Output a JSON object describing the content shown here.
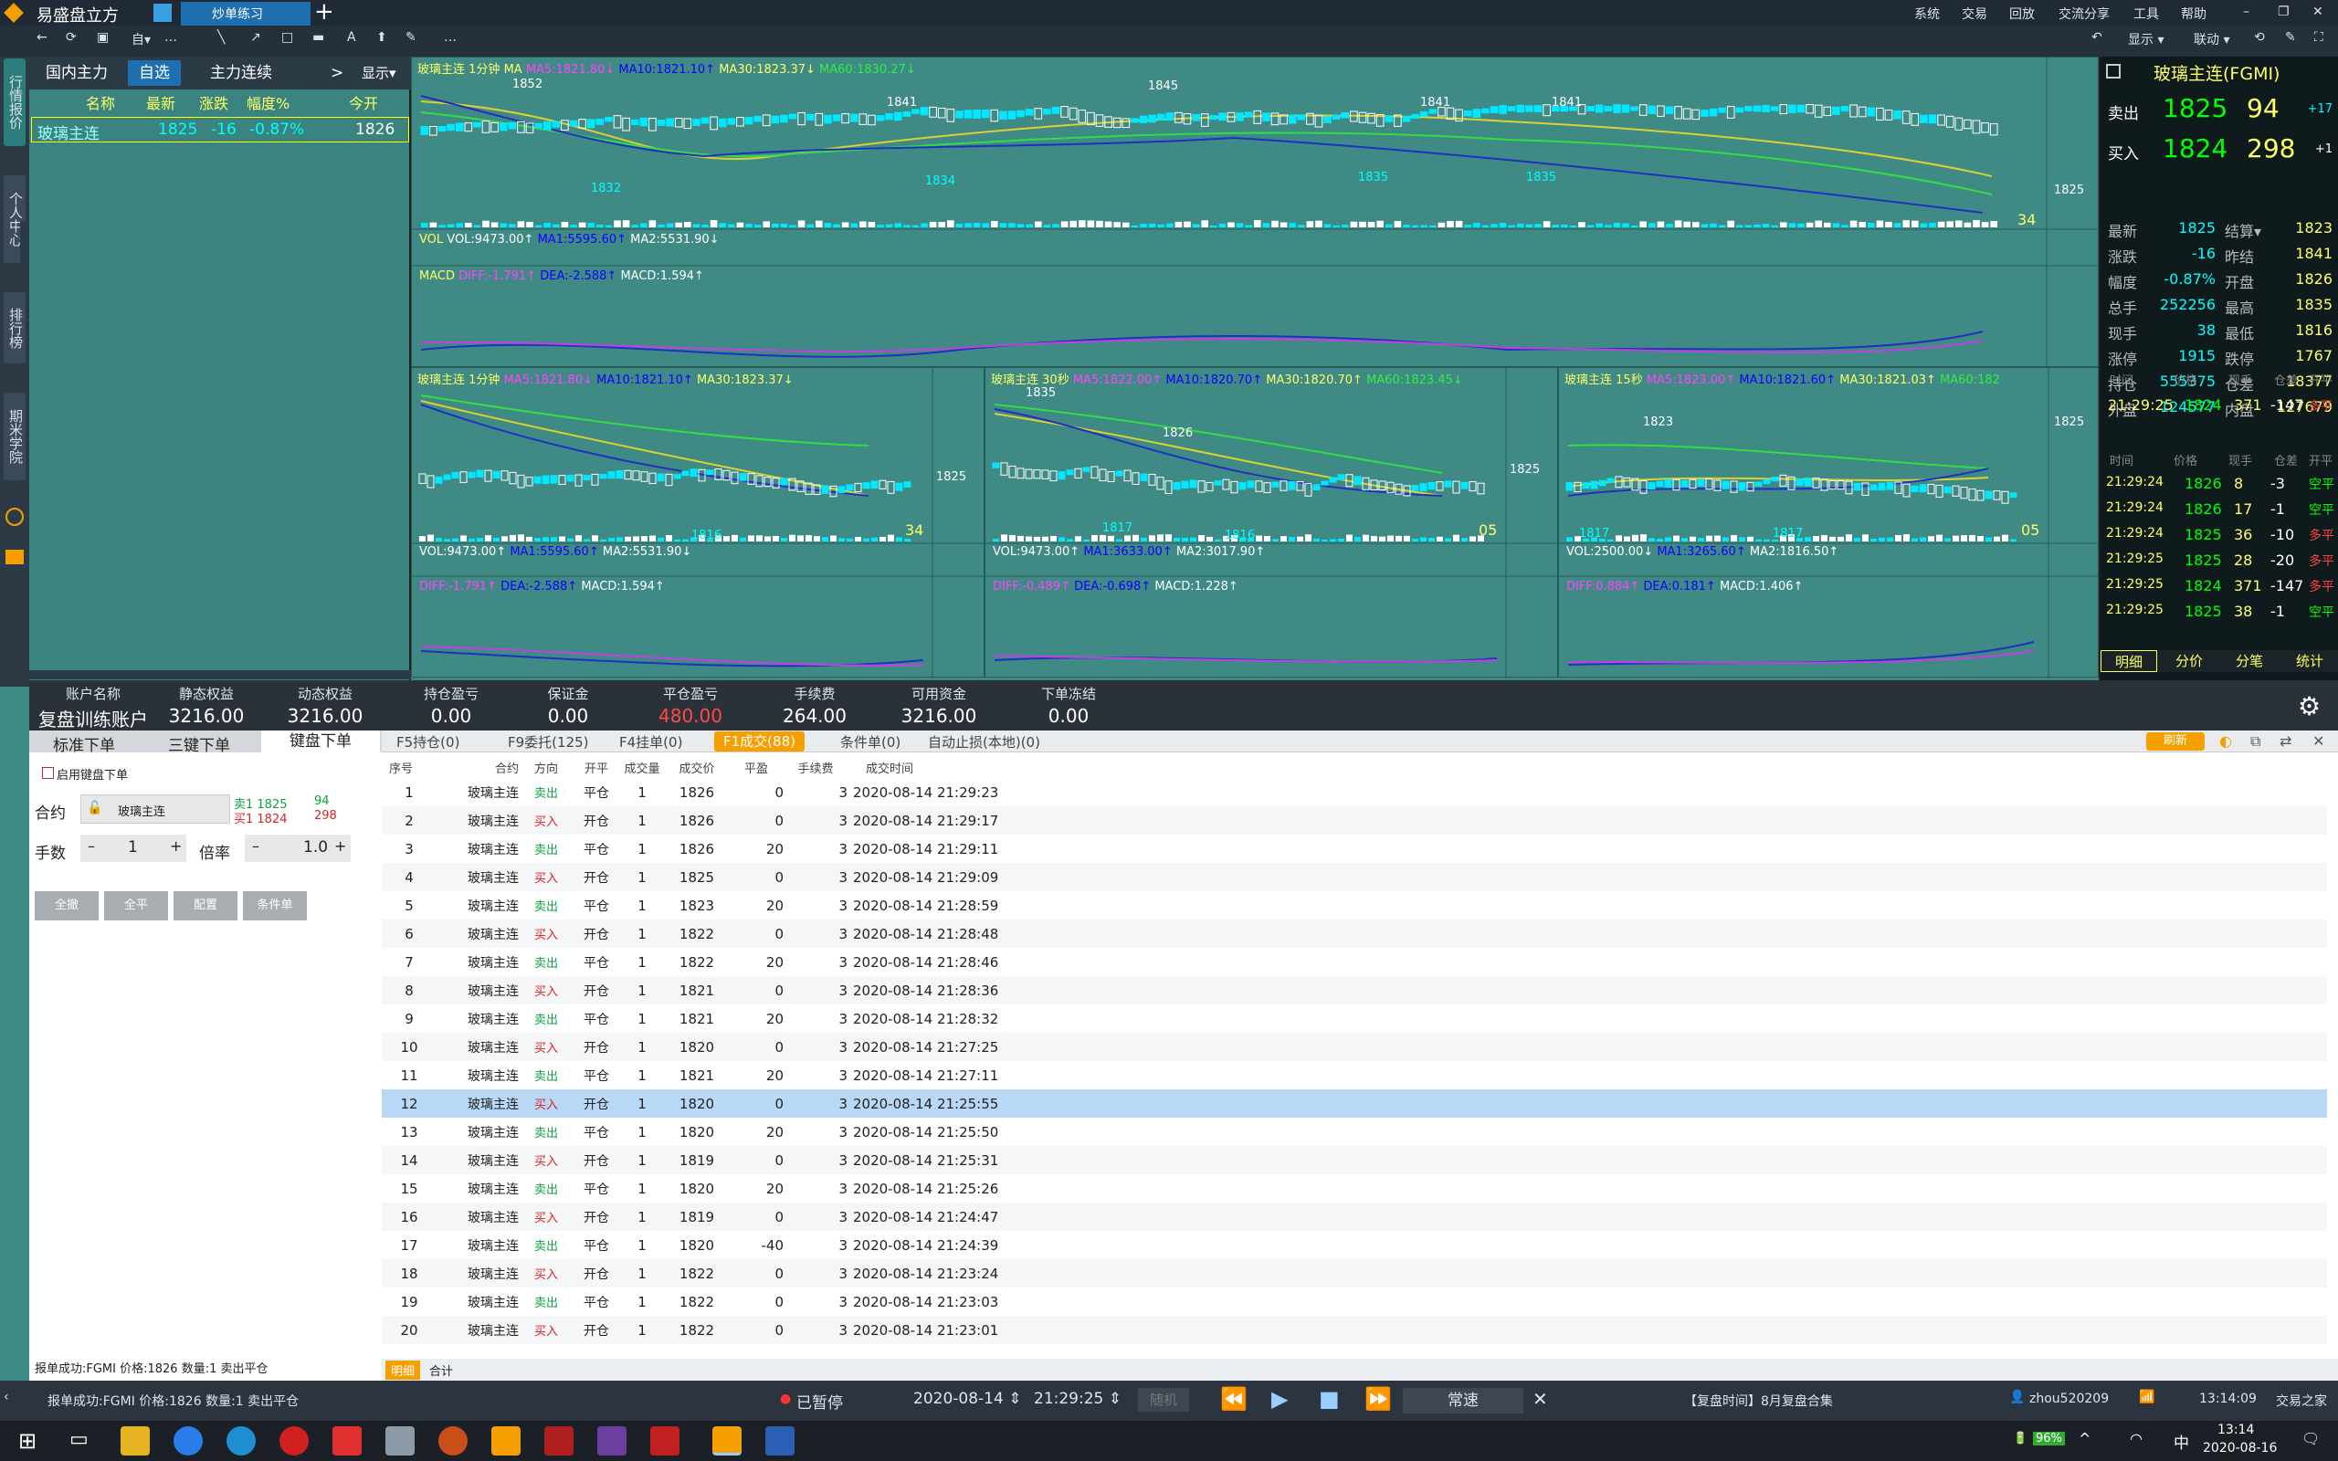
{
  "app": {
    "title": "易盛盘立方",
    "tab": "炒单练习",
    "menus": [
      "系统",
      "交易",
      "回放",
      "交流分享",
      "工具",
      "帮助"
    ],
    "display": "显示",
    "link": "联动"
  },
  "leftbar": [
    "行情报价",
    "个人中心",
    "排行榜",
    "期米学院"
  ],
  "watch": {
    "tabs": [
      "国内主力",
      "自选",
      "主力连续"
    ],
    "more": ">",
    "display": "显示▾",
    "headers": [
      "名称",
      "最新",
      "涨跌",
      "幅度%",
      "今开"
    ],
    "rows": [
      {
        "name": "玻璃主连",
        "last": "1825",
        "chg": "-16",
        "pct": "-0.87%",
        "open": "1826"
      }
    ]
  },
  "charts": {
    "main": {
      "title": "玻璃主连",
      "period": "1分钟",
      "ma": "MA",
      "ma5": "MA5:1821.80↓",
      "ma10": "MA10:1821.10↑",
      "ma30": "MA30:1823.37↓",
      "ma60": "MA60:1830.27↓",
      "vol": "VOL",
      "vol_v": "VOL:9473.00↑",
      "vol_ma1": "MA1:5595.60↑",
      "vol_ma2": "MA2:5531.90↓",
      "macd": "MACD",
      "diff": "DIFF:-1.791↑",
      "dea": "DEA:-2.588↑",
      "macd_v": "MACD:1.594↑",
      "highs": [
        "1852",
        "1841",
        "1845",
        "1841",
        "1841"
      ],
      "lows": [
        "1832",
        "1834",
        "1835",
        "1835"
      ],
      "price": "1825",
      "count": "34"
    },
    "c1": {
      "title": "玻璃主连",
      "period": "1分钟",
      "ma5": "MA5:1821.80↓",
      "ma10": "MA10:1821.10↑",
      "ma30": "MA30:1823.37↓",
      "ma60": "MA60:1830.27↓",
      "vol_v": "VOL:9473.00↑",
      "vol_ma1": "MA1:5595.60↑",
      "vol_ma2": "MA2:5531.90↓",
      "diff": "DIFF:-1.791↑",
      "dea": "DEA:-2.588↑",
      "macd_v": "MACD:1.594↑",
      "low": "1816",
      "price": "1825",
      "count": "34"
    },
    "c2": {
      "title": "玻璃主连",
      "period": "30秒",
      "ma5": "MA5:1822.00↑",
      "ma10": "MA10:1820.70↑",
      "ma30": "MA30:1820.70↑",
      "ma60": "MA60:1823.45↓",
      "vol_v": "VOL:9473.00↑",
      "vol_ma1": "MA1:3633.00↑",
      "vol_ma2": "MA2:3017.90↑",
      "diff": "DIFF:-0.489↑",
      "dea": "DEA:-0.698↑",
      "macd_v": "MACD:1.228↑",
      "high": "1835",
      "mid": "1826",
      "low1": "1817",
      "low2": "1816",
      "price": "1825",
      "count": "05"
    },
    "c3": {
      "title": "玻璃主连",
      "period": "15秒",
      "ma5": "MA5:1823.00↑",
      "ma10": "MA10:1821.60↑",
      "ma30": "MA30:1821.03↑",
      "ma60": "MA60:182",
      "vol_v": "VOL:2500.00↓",
      "vol_ma1": "MA1:3265.60↑",
      "vol_ma2": "MA2:1816.50↑",
      "diff": "DIFF:0.884↑",
      "dea": "DEA:0.181↑",
      "macd_v": "MACD:1.406↑",
      "high": "1823",
      "low1": "1817",
      "low2": "1817",
      "price": "1825",
      "count": "05"
    }
  },
  "quote": {
    "title": "玻璃主连(FGMI)",
    "sell_label": "卖出",
    "sell_price": "1825",
    "sell_vol": "94",
    "sell_chg": "+17",
    "buy_label": "买入",
    "buy_price": "1824",
    "buy_vol": "298",
    "buy_chg": "+1",
    "rows": [
      [
        "最新",
        "1825",
        "结算▾",
        "1823"
      ],
      [
        "涨跌",
        "-16",
        "昨结",
        "1841"
      ],
      [
        "幅度",
        "-0.87%",
        "开盘",
        "1826"
      ],
      [
        "总手",
        "252256",
        "最高",
        "1835"
      ],
      [
        "现手",
        "38",
        "最低",
        "1816"
      ],
      [
        "涨停",
        "1915",
        "跌停",
        "1767"
      ],
      [
        "持仓",
        "555375",
        "仓差",
        "18377"
      ],
      [
        "外盘",
        "124577",
        "内盘",
        "127679"
      ]
    ],
    "tick_headers": [
      "时间",
      "价格",
      "现手",
      "仓差",
      "开平"
    ],
    "tick_top": [
      "21:29:25",
      "1824",
      "371",
      "-147",
      "多平"
    ],
    "ticks": [
      [
        "21:29:24",
        "1826",
        "8",
        "-3",
        "空平"
      ],
      [
        "21:29:24",
        "1826",
        "17",
        "-1",
        "空平"
      ],
      [
        "21:29:24",
        "1825",
        "36",
        "-10",
        "多平"
      ],
      [
        "21:29:25",
        "1825",
        "28",
        "-20",
        "多平"
      ],
      [
        "21:29:25",
        "1824",
        "371",
        "-147",
        "多平"
      ],
      [
        "21:29:25",
        "1825",
        "38",
        "-1",
        "空平"
      ]
    ],
    "tabs": [
      "明细",
      "分价",
      "分笔",
      "统计"
    ]
  },
  "account": {
    "cols": [
      [
        "账户名称",
        "复盘训练账户"
      ],
      [
        "静态权益",
        "3216.00"
      ],
      [
        "动态权益",
        "3216.00"
      ],
      [
        "持仓盈亏",
        "0.00"
      ],
      [
        "保证金",
        "0.00"
      ],
      [
        "平仓盈亏",
        "480.00"
      ],
      [
        "手续费",
        "264.00"
      ],
      [
        "可用资金",
        "3216.00"
      ],
      [
        "下单冻结",
        "0.00"
      ]
    ]
  },
  "order": {
    "tabs": [
      "标准下单",
      "三键下单",
      "键盘下单"
    ],
    "enable": "启用键盘下单",
    "contract_label": "合约",
    "contract": "玻璃主连",
    "ask": "卖1 1825",
    "ask_vol": "94",
    "bid": "买1 1824",
    "bid_vol": "298",
    "qty_label": "手数",
    "qty": "1",
    "mult_label": "倍率",
    "mult": "1.0",
    "buttons": [
      "全撤",
      "全平",
      "配置",
      "条件单"
    ],
    "status": "报单成功:FGMI 价格:1826 数量:1 卖出平仓"
  },
  "fills": {
    "tabs": [
      "F5持仓(0)",
      "F9委托(125)",
      "F4挂单(0)",
      "F1成交(88)",
      "条件单(0)",
      "自动止损(本地)(0)"
    ],
    "refresh": "刷新",
    "headers": [
      "序号",
      "合约",
      "方向",
      "开平",
      "成交量",
      "成交价",
      "平盈",
      "手续费",
      "成交时间"
    ],
    "rows": [
      [
        "1",
        "玻璃主连",
        "卖出",
        "平仓",
        "1",
        "1826",
        "0",
        "3",
        "2020-08-14 21:29:23"
      ],
      [
        "2",
        "玻璃主连",
        "买入",
        "开仓",
        "1",
        "1826",
        "0",
        "3",
        "2020-08-14 21:29:17"
      ],
      [
        "3",
        "玻璃主连",
        "卖出",
        "平仓",
        "1",
        "1826",
        "20",
        "3",
        "2020-08-14 21:29:11"
      ],
      [
        "4",
        "玻璃主连",
        "买入",
        "开仓",
        "1",
        "1825",
        "0",
        "3",
        "2020-08-14 21:29:09"
      ],
      [
        "5",
        "玻璃主连",
        "卖出",
        "平仓",
        "1",
        "1823",
        "20",
        "3",
        "2020-08-14 21:28:59"
      ],
      [
        "6",
        "玻璃主连",
        "买入",
        "开仓",
        "1",
        "1822",
        "0",
        "3",
        "2020-08-14 21:28:48"
      ],
      [
        "7",
        "玻璃主连",
        "卖出",
        "平仓",
        "1",
        "1822",
        "20",
        "3",
        "2020-08-14 21:28:46"
      ],
      [
        "8",
        "玻璃主连",
        "买入",
        "开仓",
        "1",
        "1821",
        "0",
        "3",
        "2020-08-14 21:28:36"
      ],
      [
        "9",
        "玻璃主连",
        "卖出",
        "平仓",
        "1",
        "1821",
        "20",
        "3",
        "2020-08-14 21:28:32"
      ],
      [
        "10",
        "玻璃主连",
        "买入",
        "开仓",
        "1",
        "1820",
        "0",
        "3",
        "2020-08-14 21:27:25"
      ],
      [
        "11",
        "玻璃主连",
        "卖出",
        "平仓",
        "1",
        "1821",
        "20",
        "3",
        "2020-08-14 21:27:11"
      ],
      [
        "12",
        "玻璃主连",
        "买入",
        "开仓",
        "1",
        "1820",
        "0",
        "3",
        "2020-08-14 21:25:55"
      ],
      [
        "13",
        "玻璃主连",
        "卖出",
        "平仓",
        "1",
        "1820",
        "20",
        "3",
        "2020-08-14 21:25:50"
      ],
      [
        "14",
        "玻璃主连",
        "买入",
        "开仓",
        "1",
        "1819",
        "0",
        "3",
        "2020-08-14 21:25:31"
      ],
      [
        "15",
        "玻璃主连",
        "卖出",
        "平仓",
        "1",
        "1820",
        "20",
        "3",
        "2020-08-14 21:25:26"
      ],
      [
        "16",
        "玻璃主连",
        "买入",
        "开仓",
        "1",
        "1819",
        "0",
        "3",
        "2020-08-14 21:24:47"
      ],
      [
        "17",
        "玻璃主连",
        "卖出",
        "平仓",
        "1",
        "1820",
        "-40",
        "3",
        "2020-08-14 21:24:39"
      ],
      [
        "18",
        "玻璃主连",
        "买入",
        "开仓",
        "1",
        "1822",
        "0",
        "3",
        "2020-08-14 21:23:24"
      ],
      [
        "19",
        "玻璃主连",
        "卖出",
        "平仓",
        "1",
        "1822",
        "0",
        "3",
        "2020-08-14 21:23:03"
      ],
      [
        "20",
        "玻璃主连",
        "买入",
        "开仓",
        "1",
        "1822",
        "0",
        "3",
        "2020-08-14 21:23:01"
      ]
    ],
    "selected_row": "12",
    "bottom_tabs": [
      "明细",
      "合计"
    ]
  },
  "statusbar": {
    "msg": "报单成功:FGMI 价格:1826 数量:1 卖出平仓",
    "paused": "已暂停",
    "date": "2020-08-14",
    "time": "21:29:25",
    "random": "随机",
    "speed": "常速",
    "session": "【复盘时间】8月复盘合集",
    "user": "zhou520209",
    "clock": "13:14:09",
    "label": "交易之家"
  },
  "taskbar": {
    "time": "13:14",
    "date": "2020-08-16",
    "battery": "96%",
    "ime": "中"
  },
  "colors": {
    "up": "#ff3030",
    "down": "#00e0ff",
    "buy": "#e02020",
    "sell": "#10a040",
    "accent": "#f5a000"
  }
}
